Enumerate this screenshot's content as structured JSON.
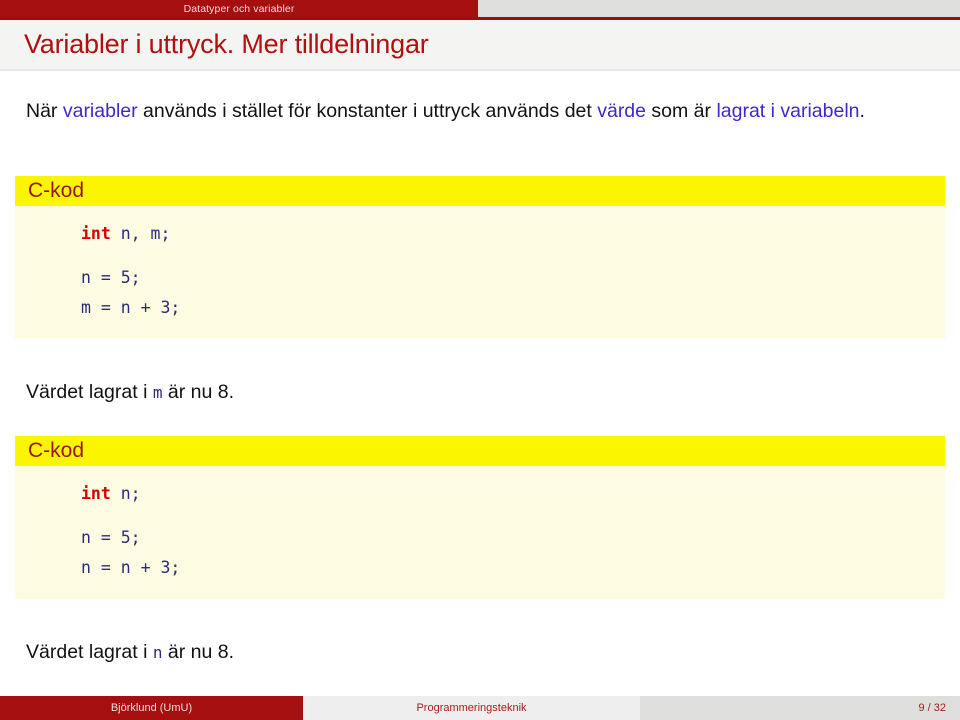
{
  "navbar": {
    "section_label": "Datatyper och variabler"
  },
  "slide": {
    "title": "Variabler i uttryck. Mer tilldelningar",
    "paragraph": {
      "part1": "När ",
      "hl1": "variabler",
      "part2": " används i stället för konstanter i uttryck används det ",
      "hl2": "värde",
      "part3": " som är ",
      "hl3": "lagrat i variabeln",
      "part4": "."
    }
  },
  "blocks": [
    {
      "title": "C-kod",
      "lines": [
        {
          "kw": "int",
          "rest": " n, m;"
        },
        {
          "kw": "",
          "rest": ""
        },
        {
          "kw": "",
          "rest": "n = 5;"
        },
        {
          "kw": "",
          "rest": "m = n + 3;"
        }
      ],
      "note_pre": "Värdet lagrat i ",
      "note_var": "m",
      "note_post": " är nu 8."
    },
    {
      "title": "C-kod",
      "lines": [
        {
          "kw": "int",
          "rest": " n;"
        },
        {
          "kw": "",
          "rest": ""
        },
        {
          "kw": "",
          "rest": "n = 5;"
        },
        {
          "kw": "",
          "rest": "n = n + 3;"
        }
      ],
      "note_pre": "Värdet lagrat i ",
      "note_var": "n",
      "note_post": " är nu 8."
    }
  ],
  "footer": {
    "author": "Björklund  (UmU)",
    "course": "Programmeringsteknik",
    "page": "9 / 32"
  },
  "colors": {
    "accent_red": "#a50f0f",
    "title_red": "#b01010",
    "block_title_bg": "#fcf500",
    "block_body_bg": "#fdfbe2",
    "highlight_blue": "#3c29c9",
    "code_blue": "#2b2b7a",
    "keyword_red": "#d40000"
  }
}
